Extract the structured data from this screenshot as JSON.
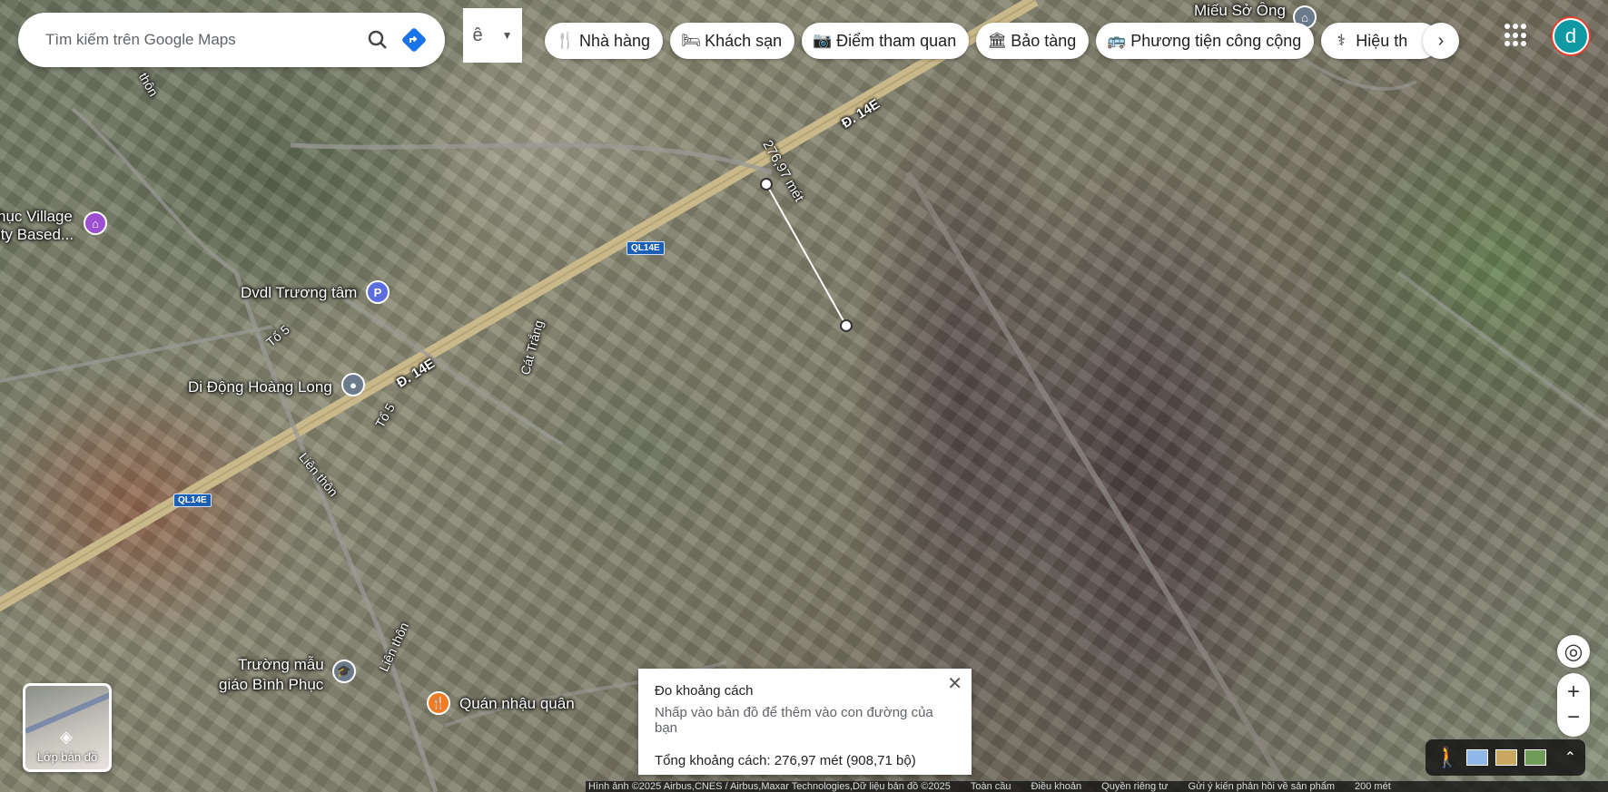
{
  "search": {
    "placeholder": "Tìm kiếm trên Google Maps"
  },
  "ime": {
    "label": "ê"
  },
  "categories": [
    {
      "label": "Nhà hàng",
      "icon": "fork-knife-icon"
    },
    {
      "label": "Khách sạn",
      "icon": "bed-icon"
    },
    {
      "label": "Điểm tham quan",
      "icon": "camera-icon"
    },
    {
      "label": "Bảo tàng",
      "icon": "museum-icon"
    },
    {
      "label": "Phương tiện công cộng",
      "icon": "bus-icon"
    },
    {
      "label": "Hiệu th",
      "icon": "pharmacy-icon"
    }
  ],
  "user": {
    "initial": "d"
  },
  "map": {
    "places": {
      "mieu": "Miếu Sở Ông",
      "village1": "hục Village",
      "village2": "ity Based...",
      "dvdl": "Dvdl Trương tâm",
      "didong": "Di Động Hoàng Long",
      "truong1": "Trường mẫu",
      "truong2": "giáo Bình Phục",
      "quan": "Quán nhậu quân"
    },
    "roads": {
      "d14e_a": "Đ. 14E",
      "d14e_b": "Đ. 14E",
      "ql_a": "QL14E",
      "ql_b": "QL14E",
      "to5_a": "Tổ 5",
      "to5_b": "Tổ 5",
      "lienthon_a": "Liên thôn",
      "lienthon_b": "Liên thôn",
      "cattrang": "Cát Trắng",
      "thon": "thôn"
    },
    "measure_label": "276,97 mét"
  },
  "measure_panel": {
    "title": "Đo khoảng cách",
    "hint": "Nhấp vào bản đồ để thêm vào con đường của bạn",
    "total": "Tổng khoảng cách: 276,97 mét (908,71 bộ)"
  },
  "layers": {
    "label": "Lớp bản đồ"
  },
  "footer": {
    "imagery": "Hình ảnh ©2025 Airbus,CNES / Airbus,Maxar Technologies,Dữ liệu bản đồ ©2025",
    "global": "Toàn cầu",
    "terms": "Điều khoản",
    "privacy": "Quyền riêng tư",
    "feedback": "Gửi ý kiến phản hồi về sản phẩm",
    "scale": "200 mét"
  }
}
